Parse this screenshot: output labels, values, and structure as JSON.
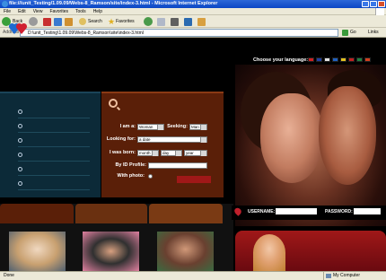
{
  "window": {
    "title": "file:///unit_Testing/1.09.09/Webs-8_Ramson/site/index-3.html - Microsoft Internet Explorer"
  },
  "menu": [
    "File",
    "Edit",
    "View",
    "Favorites",
    "Tools",
    "Help"
  ],
  "toolbar": {
    "back": "Back",
    "search": "Search",
    "favorites": "Favorites"
  },
  "address": {
    "label": "Address",
    "value": "D:\\unit_Testing\\1.09.09\\Webs-8_Ramson\\site\\index-3.html",
    "go": "Go",
    "links": "Links"
  },
  "site": {
    "language_label": "Choose your language:",
    "search": {
      "i_am_label": "I am a:",
      "i_am_value": "Woman",
      "seeking_label": "Seeking:",
      "seeking_value": "Man",
      "looking_for_label": "Looking for:",
      "looking_for_value": "a date",
      "born_label": "I was born:",
      "born_month": "month",
      "born_day": "day",
      "born_year": "year",
      "id_label": "By ID Profile:",
      "photo_label": "With photo:"
    },
    "login": {
      "username_label": "USERNAME:",
      "password_label": "PASSWORD:"
    },
    "colors": {
      "nav_panel": "#0c2a38",
      "search_panel": "#5a1f08",
      "promo": "#a01818"
    }
  },
  "status": {
    "text": "Done",
    "zone": "My Computer"
  }
}
